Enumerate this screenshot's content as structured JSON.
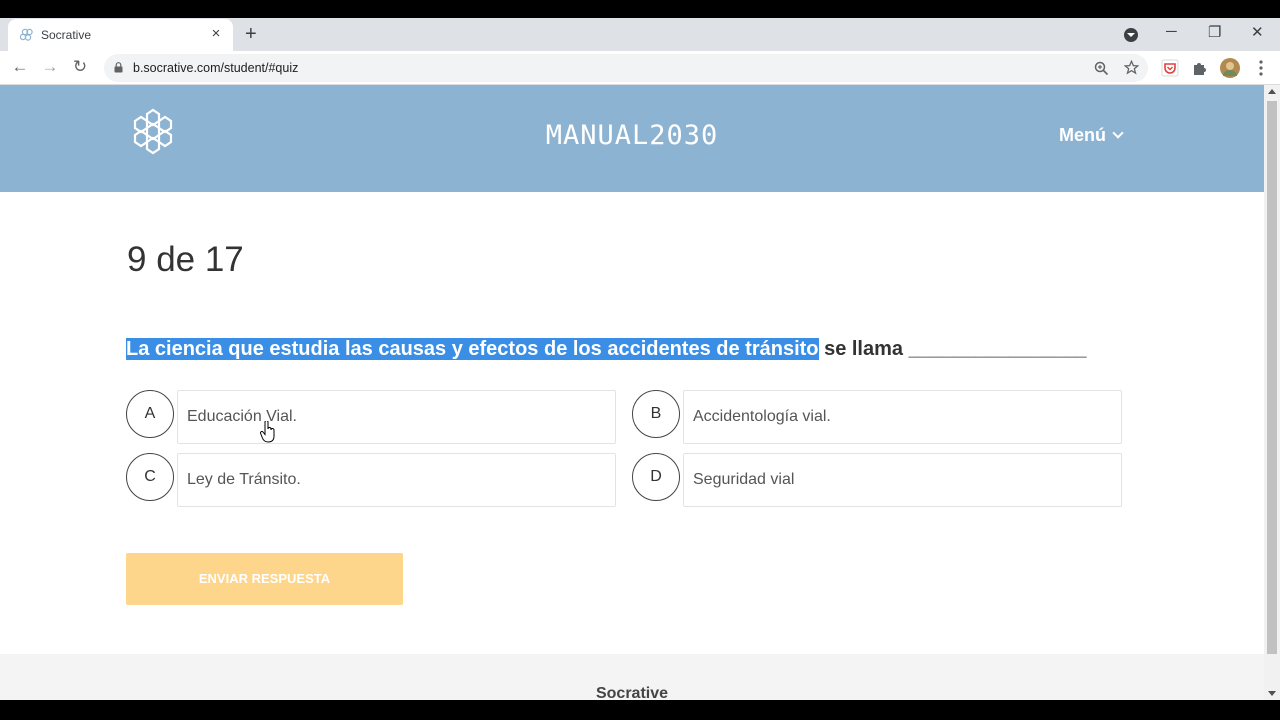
{
  "browser": {
    "tab_title": "Socrative",
    "tab_close": "×",
    "new_tab": "+",
    "url": "b.socrative.com/student/#quiz",
    "window_controls": {
      "minimize": "─",
      "restore": "❐",
      "close": "✕"
    },
    "nav": {
      "back": "←",
      "forward": "→",
      "reload": "↻"
    },
    "icons": {
      "zoom": "zoom-icon",
      "star": "star-icon",
      "pocket": "pocket-icon",
      "extensions": "puzzle-icon",
      "profile": "avatar",
      "more": "kebab-menu-icon"
    }
  },
  "header": {
    "room_name": "MANUAL2030",
    "menu_label": "Menú",
    "bg_color": "#8db3d2"
  },
  "quiz": {
    "progress": "9 de 17",
    "question_highlighted": "La ciencia que estudia las causas y efectos de los accidentes de tránsito",
    "question_rest": " se llama ________________",
    "choices": [
      {
        "letter": "A",
        "text": "Educación Vial."
      },
      {
        "letter": "B",
        "text": "Accidentología vial."
      },
      {
        "letter": "C",
        "text": "Ley de Tránsito."
      },
      {
        "letter": "D",
        "text": "Seguridad vial"
      }
    ],
    "submit_label": "ENVIAR RESPUESTA",
    "submit_color": "#fdd58b"
  },
  "footer": {
    "brand": "Socrative"
  }
}
